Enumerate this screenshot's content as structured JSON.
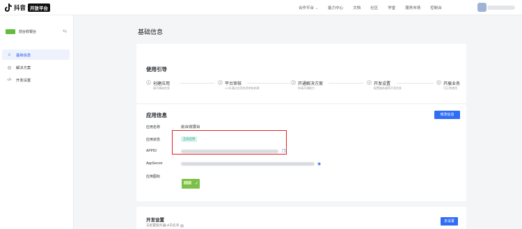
{
  "header": {
    "brand": "抖音",
    "badge": "开放平台",
    "nav": [
      {
        "label": "合作平台",
        "dropdown": true
      },
      {
        "label": "能力中心"
      },
      {
        "label": "文档"
      },
      {
        "label": "社区"
      },
      {
        "label": "学堂"
      },
      {
        "label": "服务市场"
      },
      {
        "label": "控制台"
      }
    ],
    "user_name": "▒▒▒▒▒"
  },
  "sidebar": {
    "app_name": "前台收银台",
    "items": [
      {
        "label": "基础信息",
        "icon": "home-icon",
        "active": true
      },
      {
        "label": "解决方案",
        "icon": "location-icon",
        "active": false
      },
      {
        "label": "开发设置",
        "icon": "code-icon",
        "active": false
      }
    ]
  },
  "page": {
    "title": "基础信息"
  },
  "guide": {
    "title": "使用引导",
    "steps": [
      {
        "num": "1",
        "name": "创建应用",
        "desc": "填写基础信息"
      },
      {
        "num": "2",
        "name": "平台审核",
        "desc": "1-3天通过应用信息审核结果"
      },
      {
        "num": "3",
        "name": "开通解决方案",
        "desc": "申请开通能力"
      },
      {
        "num": "4",
        "name": "开发设置",
        "desc": "配置服务器等开发信息"
      },
      {
        "num": "5",
        "name": "开展业务",
        "desc": "可正常使用"
      }
    ]
  },
  "app_info": {
    "title": "应用信息",
    "edit_button": "修改信息",
    "name_label": "应用名称",
    "name_value": "前台收银台",
    "status_label": "应用状态",
    "status_value": "正式应用",
    "appid_label": "APPID",
    "appsecret_label": "AppSecret",
    "icon_label": "应用图标"
  },
  "dev_settings": {
    "title": "开发设置",
    "desc": "去配置服务器url白名单",
    "button": "去设置"
  },
  "colors": {
    "primary": "#2f6df6",
    "active_bg": "#eef2fc",
    "highlight_border": "#e02020",
    "status_bg": "#d9f3ee",
    "status_text": "#2aa58b",
    "app_icon": "#64bb3c"
  }
}
